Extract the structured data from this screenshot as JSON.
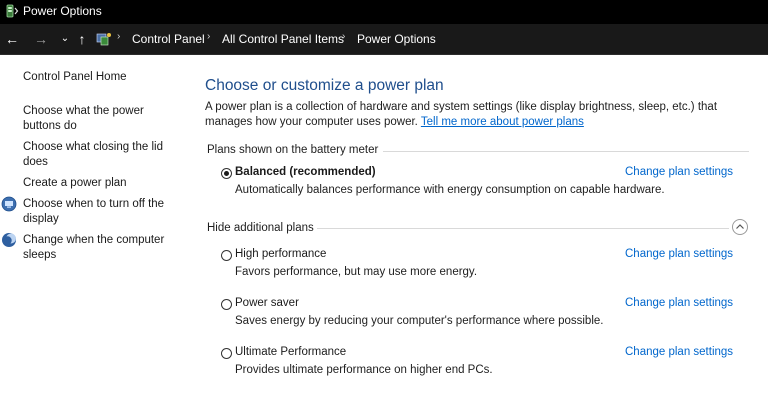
{
  "window": {
    "title": "Power Options"
  },
  "nav": {
    "back_icon": "←",
    "forward_icon": "→",
    "recent_icon": "⌄",
    "up_icon": "↑",
    "breadcrumbs": [
      "Control Panel",
      "All Control Panel Items",
      "Power Options"
    ],
    "separator": "›"
  },
  "sidebar": {
    "items": [
      {
        "label": "Control Panel Home"
      },
      {
        "label": "Choose what the power buttons do"
      },
      {
        "label": "Choose what closing the lid does"
      },
      {
        "label": "Create a power plan"
      },
      {
        "label": "Choose when to turn off the display",
        "icon": "display-icon"
      },
      {
        "label": "Change when the computer sleeps",
        "icon": "moon-icon"
      }
    ]
  },
  "main": {
    "heading": "Choose or customize a power plan",
    "description": "A power plan is a collection of hardware and system settings (like display brightness, sleep, etc.) that manages how your computer uses power.",
    "learn_more_link": "Tell me more about power plans",
    "battery_section_title": "Plans shown on the battery meter",
    "additional_section_title": "Hide additional plans",
    "change_link_label": "Change plan settings",
    "plans": [
      {
        "name": "Balanced (recommended)",
        "description": "Automatically balances performance with energy consumption on capable hardware.",
        "selected": true
      },
      {
        "name": "High performance",
        "description": "Favors performance, but may use more energy.",
        "selected": false
      },
      {
        "name": "Power saver",
        "description": "Saves energy by reducing your computer's performance where possible.",
        "selected": false
      },
      {
        "name": "Ultimate Performance",
        "description": "Provides ultimate performance on higher end PCs.",
        "selected": false
      }
    ]
  },
  "colors": {
    "titlebar_bg": "#000000",
    "navbar_bg": "#191919",
    "heading": "#1f4e8c",
    "link": "#0066cc"
  }
}
